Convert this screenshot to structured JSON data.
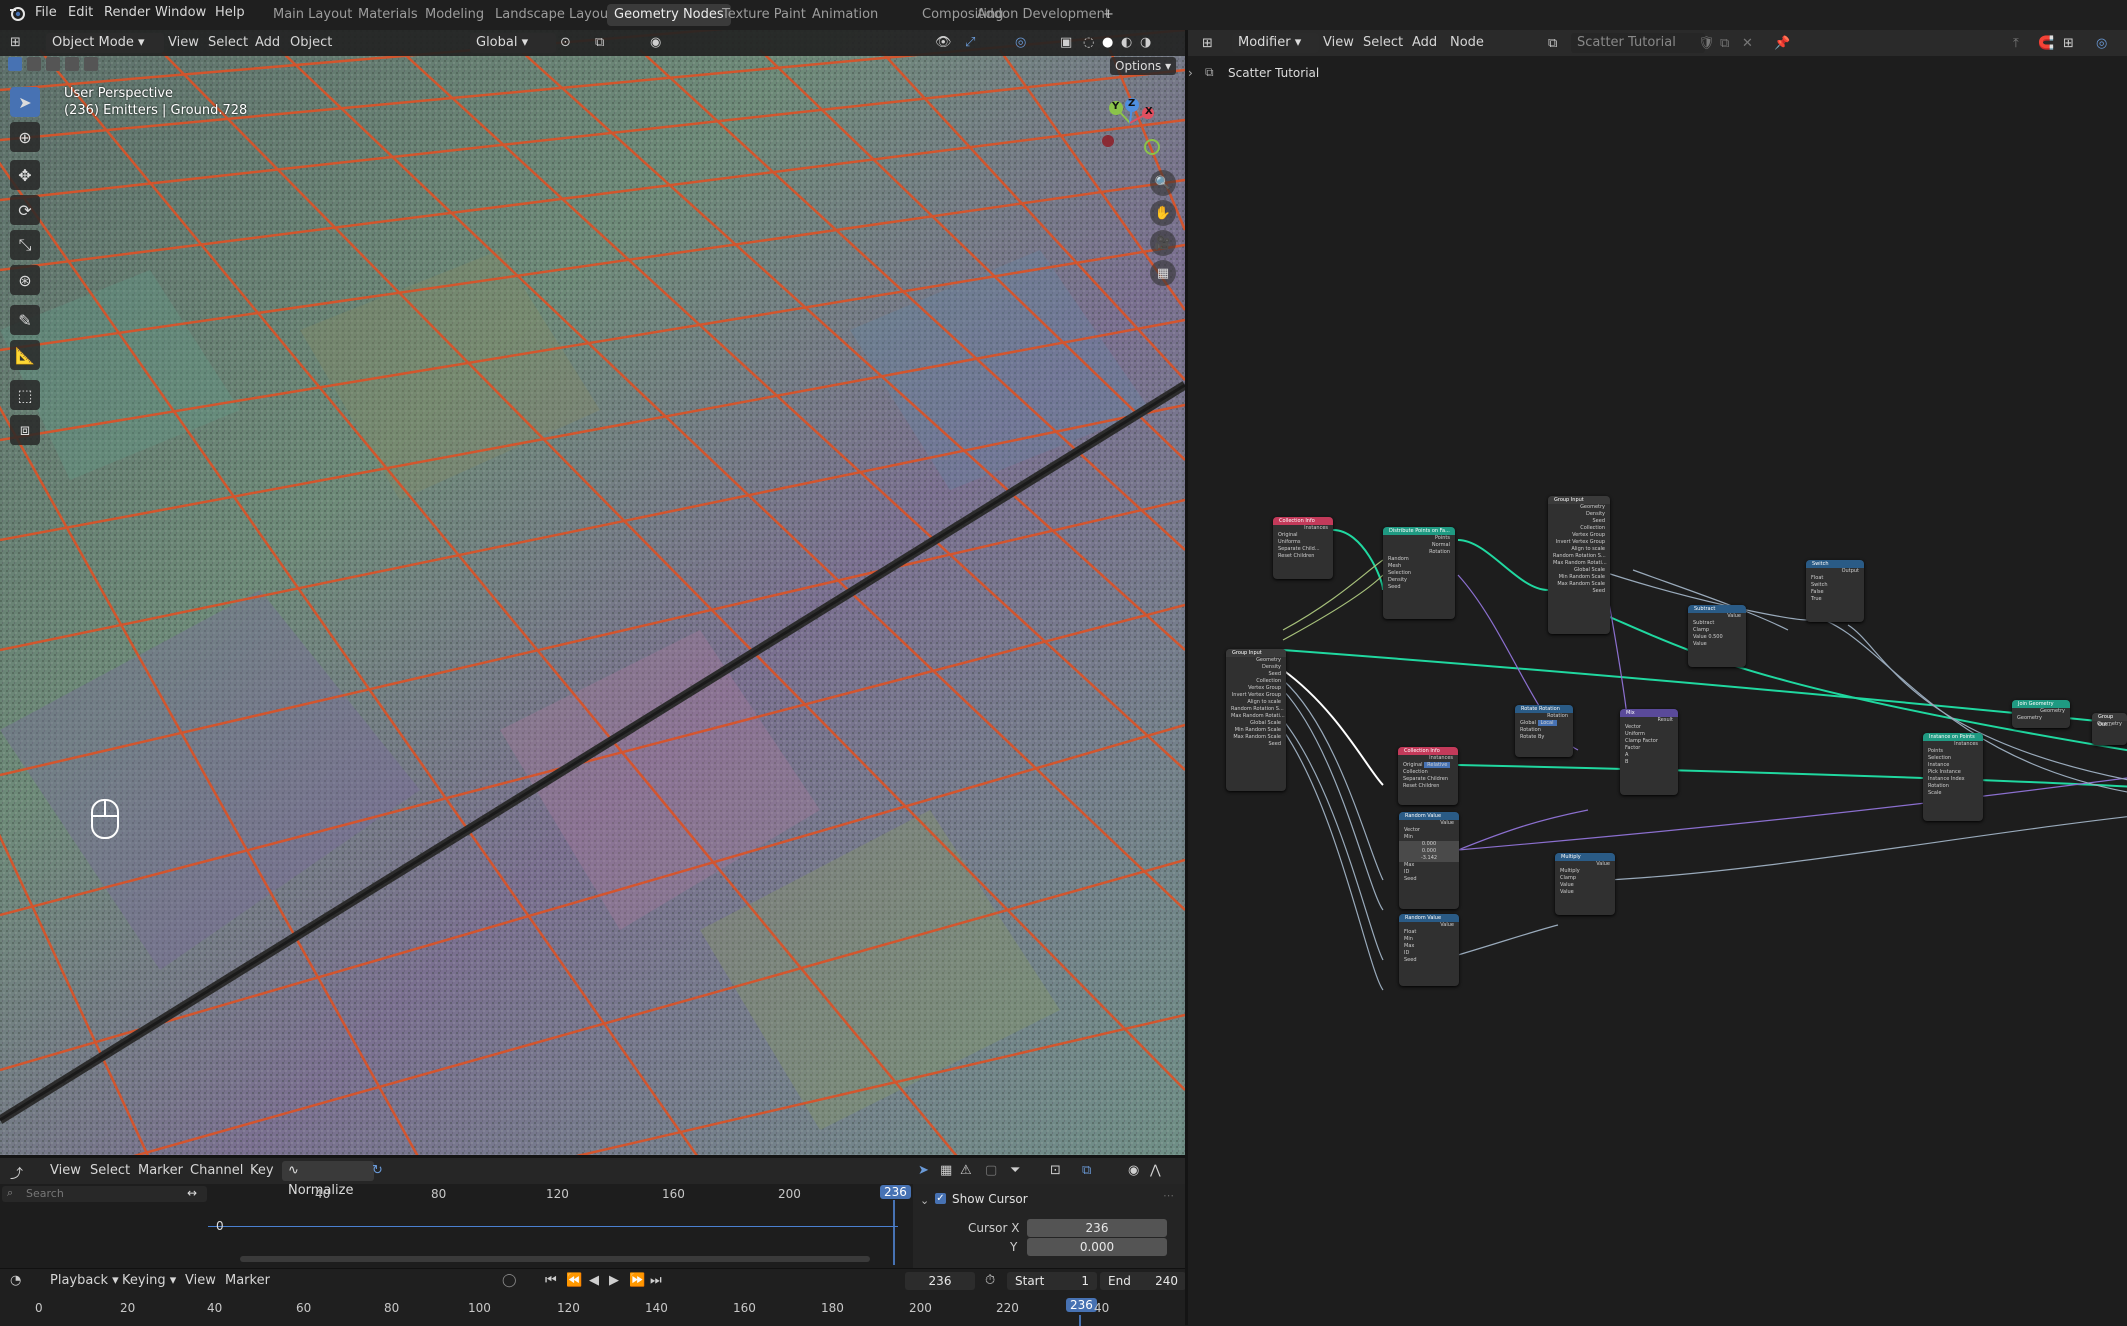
{
  "topbar": {
    "menus": [
      "File",
      "Edit",
      "Render",
      "Window",
      "Help"
    ],
    "workspaces": [
      "Main Layout",
      "Materials",
      "Modeling",
      "Landscape Layout",
      "Geometry Nodes",
      "Texture Paint",
      "Animation",
      "Compositing",
      "Addon Development"
    ],
    "active_workspace": "Geometry Nodes",
    "add_tab": "+"
  },
  "viewport": {
    "mode": "Object Mode",
    "menus": [
      "View",
      "Select",
      "Add",
      "Object"
    ],
    "orientation": "Global",
    "options": "Options",
    "perspective": "User Perspective",
    "info": "(236) Emitters | Ground.728",
    "gizmo": {
      "x": "X",
      "y": "Y",
      "z": "Z"
    }
  },
  "node_editor": {
    "editor_type": "Modifier",
    "menus": [
      "View",
      "Select",
      "Add",
      "Node"
    ],
    "tree_name": "Scatter Tutorial",
    "breadcrumb": "Scatter Tutorial",
    "nodes": {
      "collection_info_1": {
        "title": "Collection Info",
        "rows": [
          "Instances",
          "Original",
          "Relative",
          "Uniforms",
          "Separate Child...",
          "Reset Children"
        ]
      },
      "distribute": {
        "title": "Distribute Points on Fa...",
        "rows": [
          "Points",
          "Normal",
          "Rotation",
          "Random",
          "Mesh",
          "Selection",
          "Density",
          "Seed"
        ]
      },
      "group_input_top": {
        "title": "Group Input",
        "rows": [
          "Geometry",
          "Density",
          "Seed",
          "Collection",
          "Vertex Group",
          "Invert Vertex Group",
          "Align to scale",
          "Random Rotation S...",
          "Max Random Rotati...",
          "Global Scale",
          "Min Random Scale",
          "Max Random Scale",
          "Seed"
        ]
      },
      "group_input_main": {
        "title": "Group Input",
        "rows": [
          "Geometry",
          "Density",
          "Seed",
          "Collection",
          "Vertex Group",
          "Invert Vertex Group",
          "Align to scale",
          "Random Rotation S...",
          "Max Random Rotati...",
          "Global Scale",
          "Min Random Scale",
          "Max Random Scale",
          "Seed"
        ]
      },
      "subtract": {
        "title": "Subtract",
        "rows": [
          "Value",
          "Subtract",
          "Clamp",
          "Value  0.500",
          "Value"
        ]
      },
      "switch": {
        "title": "Switch",
        "rows": [
          "Output",
          "Float",
          "Switch",
          "False",
          "True"
        ]
      },
      "rotate_rotation": {
        "title": "Rotate Rotation",
        "rows": [
          "Rotation",
          "Global",
          "Local",
          "Rotation",
          "Rotate By"
        ]
      },
      "mix": {
        "title": "Mix",
        "rows": [
          "Result",
          "Vector",
          "Uniform",
          "Clamp Factor",
          "Factor",
          "A",
          "B"
        ]
      },
      "collection_info_2": {
        "title": "Collection Info",
        "rows": [
          "Instances",
          "Original",
          "Relative",
          "Collection",
          "Separate Children",
          "Reset Children"
        ]
      },
      "random_value_1": {
        "title": "Random Value",
        "rows": [
          "Value",
          "Vector",
          "Min",
          "0.000",
          "0.000",
          "-3.142",
          "Max",
          "ID",
          "Seed"
        ]
      },
      "random_value_2": {
        "title": "Random Value",
        "rows": [
          "Value",
          "Float",
          "Min",
          "Max",
          "ID",
          "Seed"
        ]
      },
      "multiply": {
        "title": "Multiply",
        "rows": [
          "Value",
          "Multiply",
          "Clamp",
          "Value",
          "Value"
        ]
      },
      "instance_on_points": {
        "title": "Instance on Points",
        "rows": [
          "Instances",
          "Points",
          "Selection",
          "Instance",
          "Pick Instance",
          "Instance Index",
          "Rotation",
          "Scale"
        ]
      },
      "join_geometry": {
        "title": "Join Geometry",
        "rows": [
          "Geometry",
          "Geometry"
        ]
      },
      "group_output": {
        "title": "Group Out...",
        "rows": [
          "Geometry"
        ]
      }
    }
  },
  "graph_editor": {
    "menus": [
      "View",
      "Select",
      "Marker",
      "Channel",
      "Key"
    ],
    "normalize": "Normalize",
    "search_placeholder": "Search",
    "ruler": [
      "40",
      "80",
      "120",
      "160",
      "200"
    ],
    "current_frame_badge": "236",
    "zero_label": "0",
    "show_cursor": "Show Cursor",
    "cursor_x_label": "Cursor X",
    "cursor_x": "236",
    "y_label": "Y",
    "y_value": "0.000"
  },
  "timeline": {
    "menus": [
      "Playback",
      "Keying",
      "View",
      "Marker"
    ],
    "frame": "236",
    "start_label": "Start",
    "start": "1",
    "end_label": "End",
    "end": "240",
    "ruler": [
      "0",
      "20",
      "40",
      "60",
      "80",
      "100",
      "120",
      "140",
      "160",
      "180",
      "200",
      "220"
    ],
    "current_badge": "236",
    "tail": "40"
  }
}
